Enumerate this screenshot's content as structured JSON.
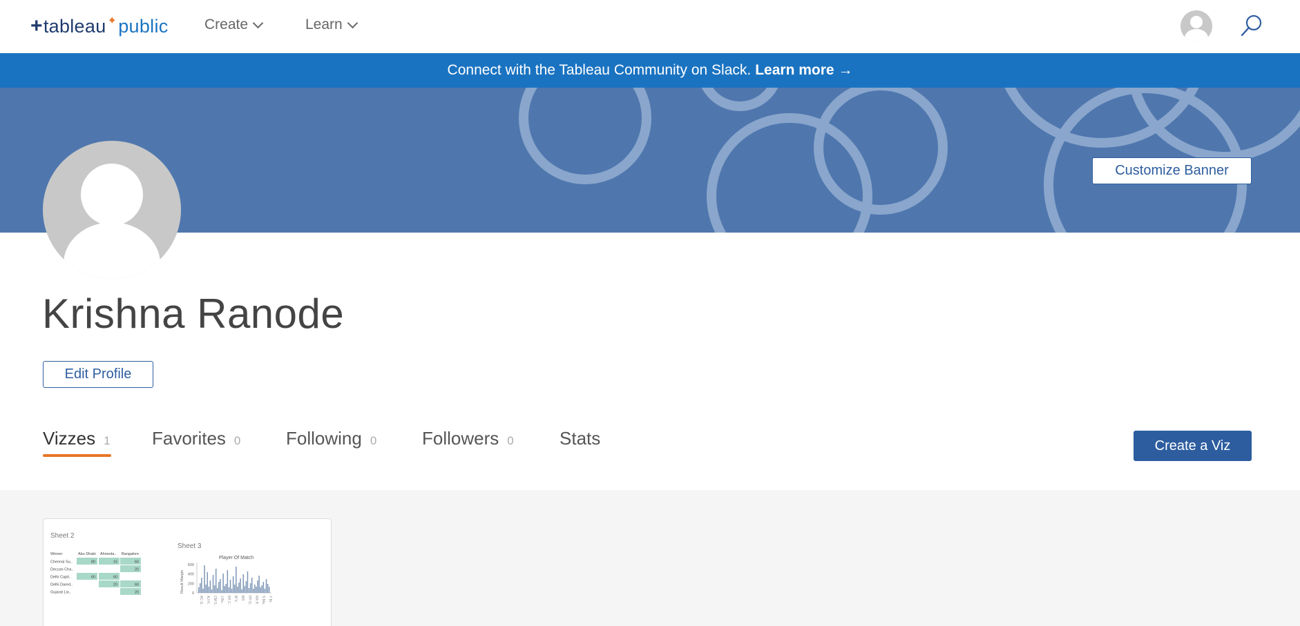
{
  "nav": {
    "logo": {
      "plus": "+",
      "tableau": "tableau",
      "public": "public"
    },
    "create_label": "Create",
    "learn_label": "Learn"
  },
  "slack_banner": {
    "text": "Connect with the Tableau Community on Slack.",
    "link": "Learn more →"
  },
  "banner": {
    "customize_label": "Customize Banner",
    "color": "#4f77ae",
    "circle_color": "#8aa6cc"
  },
  "profile": {
    "name": "Krishna Ranode",
    "edit_label": "Edit Profile"
  },
  "tabs": [
    {
      "label": "Vizzes",
      "count": "1",
      "active": true
    },
    {
      "label": "Favorites",
      "count": "0"
    },
    {
      "label": "Following",
      "count": "0"
    },
    {
      "label": "Followers",
      "count": "0"
    },
    {
      "label": "Stats",
      "count": ""
    }
  ],
  "create_viz_label": "Create a Viz",
  "viz_card": {
    "sheet2": {
      "title": "Sheet 2",
      "headers": [
        "Winner",
        "Abu Dhabi",
        "Ahmeda..",
        "Bangalore"
      ],
      "rows": [
        {
          "label": "Chennai Su..",
          "cells": [
            "80",
            "15",
            "60"
          ]
        },
        {
          "label": "Deccan Cha..",
          "cells": [
            "",
            "",
            "20"
          ]
        },
        {
          "label": "Delhi Capit..",
          "cells": [
            "60",
            "60",
            ""
          ]
        },
        {
          "label": "Delhi Dared..",
          "cells": [
            "",
            "20",
            "60"
          ]
        },
        {
          "label": "Gujarat Lio..",
          "cells": [
            "",
            "",
            "20"
          ]
        }
      ]
    },
    "sheet3": {
      "title": "Sheet 3",
      "chart_title": "Player Of Match",
      "ylabel": "Result Margin",
      "yticks": [
        "600",
        "400",
        "200",
        "0"
      ],
      "xticks": [
        "AC G..",
        "AJ H..",
        "CM S..",
        "J Bo..",
        "KK C..",
        "M V..",
        "MS",
        "PP O..",
        "RR P..",
        "S Ma..",
        "Y M.."
      ]
    },
    "accent": "#a8d8c8"
  },
  "colors": {
    "primary": "#2d5d9f",
    "slack_bg": "#1a73c1",
    "tab_underline": "#e97627"
  }
}
